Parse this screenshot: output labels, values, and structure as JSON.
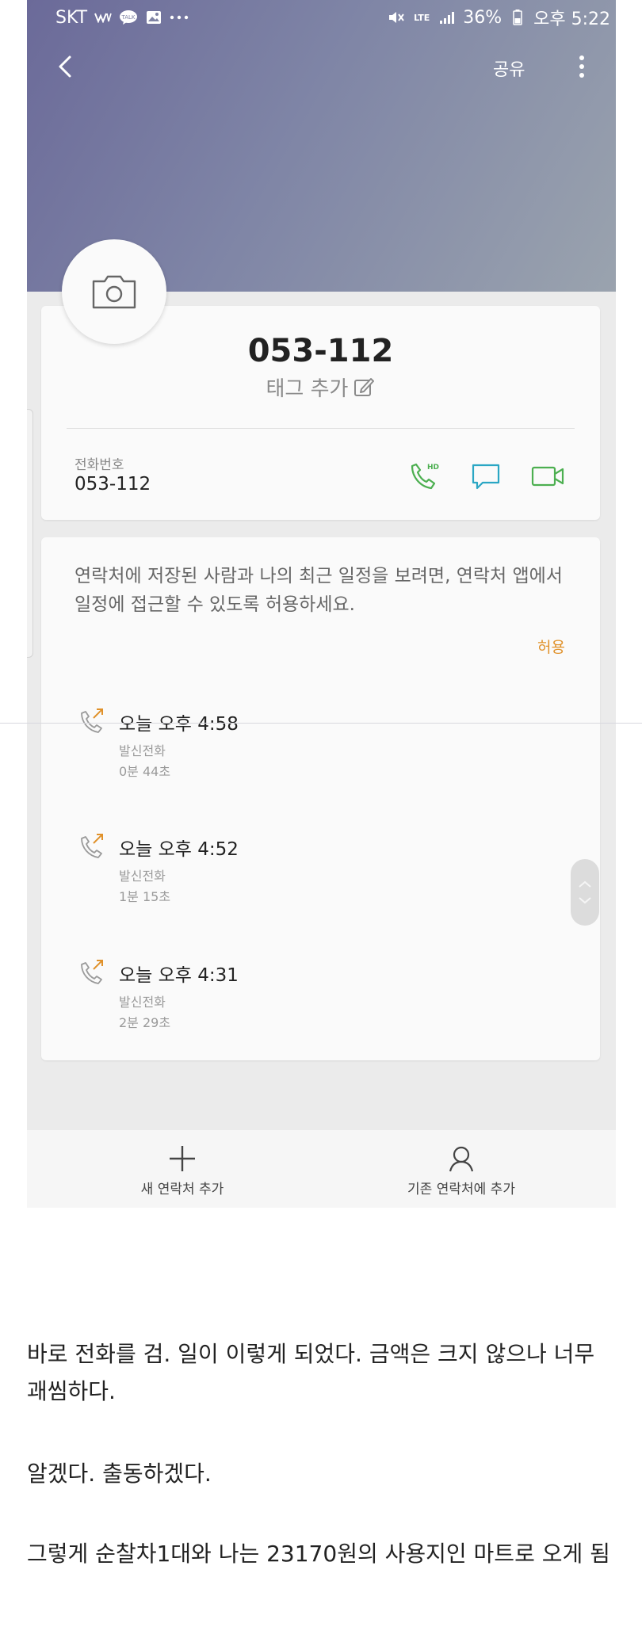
{
  "status_bar": {
    "carrier": "SKT",
    "battery": "36%",
    "time": "오후 5:22",
    "network": "LTE",
    "icons": [
      "w-icon",
      "talk-icon",
      "image-icon",
      "more-dots",
      "mute-icon",
      "signal-icon",
      "battery-icon"
    ]
  },
  "app_bar": {
    "share_label": "공유"
  },
  "contact": {
    "name": "053-112",
    "tag_add": "태그 추가",
    "phone_label": "전화번호",
    "phone_value": "053-112"
  },
  "calendar_permission": {
    "message": "연락처에 저장된 사람과 나의 최근 일정을 보려면, 연락처 앱에서 일정에 접근할 수 있도록 허용하세요.",
    "allow_label": "허용"
  },
  "call_log": [
    {
      "time": "오늘 오후 4:58",
      "type": "발신전화",
      "duration": "0분 44초"
    },
    {
      "time": "오늘 오후 4:52",
      "type": "발신전화",
      "duration": "1분 15초"
    },
    {
      "time": "오늘 오후 4:31",
      "type": "발신전화",
      "duration": "2분 29초"
    }
  ],
  "bottom_bar": {
    "new_contact": "새 연락처 추가",
    "existing_contact": "기존 연락처에 추가"
  },
  "article": {
    "p1": "바로 전화를 검. 일이 이렇게 되었다. 금액은 크지 않으나 너무 괘씸하다.",
    "p2": "알겠다. 출동하겠다.",
    "p3": "그렇게 순찰차1대와 나는 23170원의 사용지인 마트로 오게 됨"
  },
  "colors": {
    "header_gradient_start": "#6b6a99",
    "header_gradient_end": "#9aa3ae",
    "call_green": "#4caf50",
    "message_blue": "#2aa6c4",
    "allow_orange": "#e0912a",
    "outgoing_arrow": "#e0912a"
  }
}
